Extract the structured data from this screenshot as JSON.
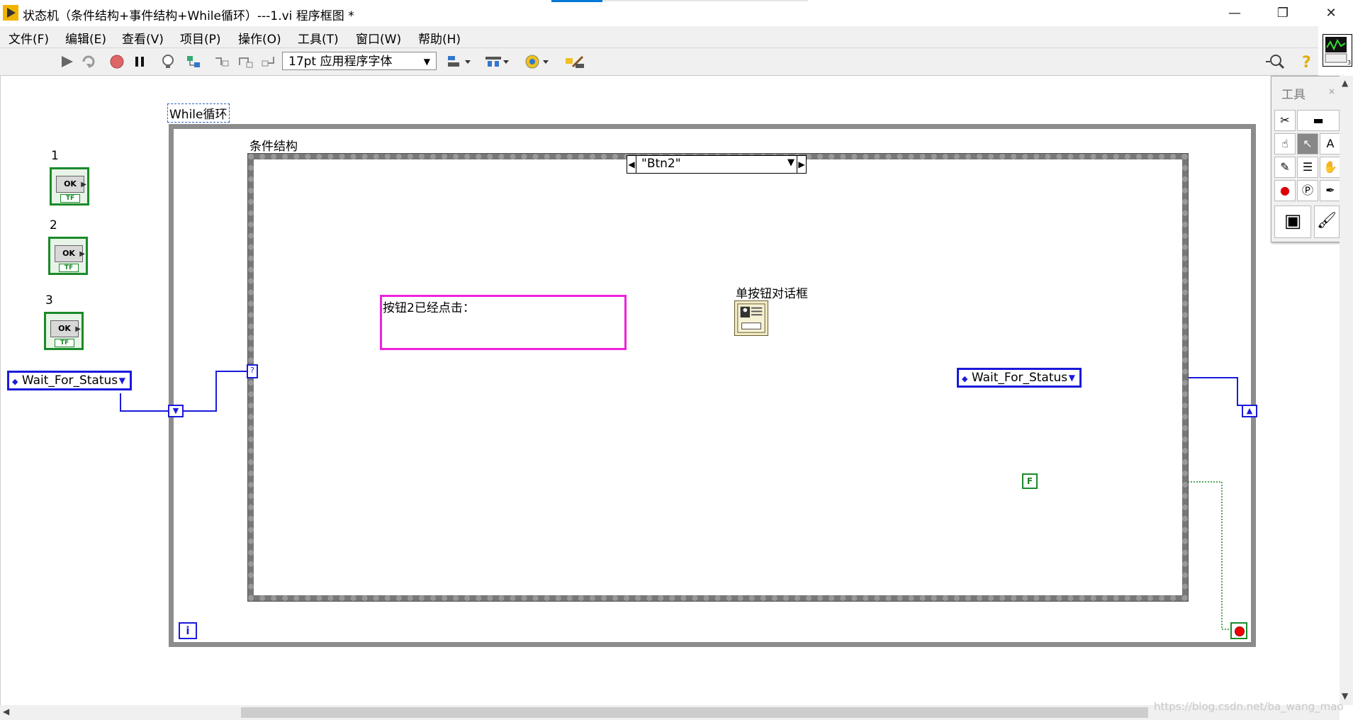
{
  "window": {
    "title": "状态机（条件结构+事件结构+While循环）---1.vi 程序框图 *",
    "controls": {
      "minimize": "—",
      "restore": "❐",
      "close": "✕"
    }
  },
  "menu": {
    "items": [
      "文件(F)",
      "编辑(E)",
      "查看(V)",
      "项目(P)",
      "操作(O)",
      "工具(T)",
      "窗口(W)",
      "帮助(H)"
    ]
  },
  "toolbar": {
    "font": "17pt 应用程序字体"
  },
  "diagram": {
    "while_loop_label": "While循环",
    "case_structure_label": "条件结构",
    "case_selector_value": "\"Btn2\"",
    "buttons": [
      {
        "label": "1",
        "face": "OK",
        "tf": "TF"
      },
      {
        "label": "2",
        "face": "OK",
        "tf": "TF"
      },
      {
        "label": "3",
        "face": "OK",
        "tf": "TF"
      }
    ],
    "enum_outside": "Wait_For_Status",
    "enum_inside": "Wait_For_Status",
    "string_constant": "按钮2已经点击：",
    "dialog_label": "单按钮对话框",
    "false_constant": "F",
    "iteration_terminal": "i",
    "case_selector_terminal": "?"
  },
  "tools_palette": {
    "title": "工具"
  },
  "watermark": "https://blog.csdn.net/ba_wang_mao",
  "colors": {
    "enum_wire": "#1a1adc",
    "string_wire": "#ee22dd",
    "bool_wire": "#1a8a2a",
    "loop_border": "#8c8c8c"
  }
}
